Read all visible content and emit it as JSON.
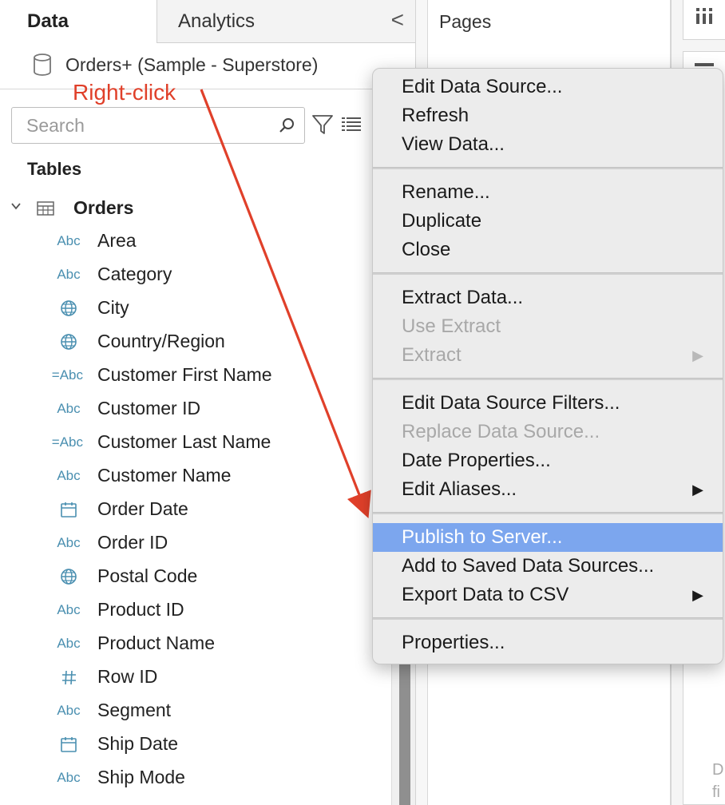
{
  "data_pane": {
    "tabs": [
      {
        "label": "Data",
        "active": true
      },
      {
        "label": "Analytics",
        "active": false
      }
    ],
    "collapse_glyph": "<",
    "data_source": {
      "name": "Orders+ (Sample - Superstore)",
      "icon": "cylinder-database-icon"
    },
    "search": {
      "placeholder": "Search",
      "value": ""
    },
    "tables_heading": "Tables",
    "table": {
      "name": "Orders",
      "fields": [
        {
          "name": "Area",
          "type": "string",
          "icon_text": "Abc"
        },
        {
          "name": "Category",
          "type": "string",
          "icon_text": "Abc"
        },
        {
          "name": "City",
          "type": "geographic",
          "icon_text": ""
        },
        {
          "name": "Country/Region",
          "type": "geographic",
          "icon_text": ""
        },
        {
          "name": "Customer First Name",
          "type": "calculated-string",
          "icon_text": "=Abc"
        },
        {
          "name": "Customer ID",
          "type": "string",
          "icon_text": "Abc"
        },
        {
          "name": "Customer Last Name",
          "type": "calculated-string",
          "icon_text": "=Abc"
        },
        {
          "name": "Customer Name",
          "type": "string",
          "icon_text": "Abc"
        },
        {
          "name": "Order Date",
          "type": "date",
          "icon_text": ""
        },
        {
          "name": "Order ID",
          "type": "string",
          "icon_text": "Abc"
        },
        {
          "name": "Postal Code",
          "type": "geographic",
          "icon_text": ""
        },
        {
          "name": "Product ID",
          "type": "string",
          "icon_text": "Abc"
        },
        {
          "name": "Product Name",
          "type": "string",
          "icon_text": "Abc"
        },
        {
          "name": "Row ID",
          "type": "number",
          "icon_text": "#"
        },
        {
          "name": "Segment",
          "type": "string",
          "icon_text": "Abc"
        },
        {
          "name": "Ship Date",
          "type": "date",
          "icon_text": ""
        },
        {
          "name": "Ship Mode",
          "type": "string",
          "icon_text": "Abc"
        }
      ]
    }
  },
  "shelves": {
    "pages_label": "Pages",
    "drop_hint": "D\nfi"
  },
  "context_menu": {
    "groups": [
      [
        {
          "label": "Edit Data Source...",
          "enabled": true
        },
        {
          "label": "Refresh",
          "enabled": true
        },
        {
          "label": "View Data...",
          "enabled": true
        }
      ],
      [
        {
          "label": "Rename...",
          "enabled": true
        },
        {
          "label": "Duplicate",
          "enabled": true
        },
        {
          "label": "Close",
          "enabled": true
        }
      ],
      [
        {
          "label": "Extract Data...",
          "enabled": true
        },
        {
          "label": "Use Extract",
          "enabled": false
        },
        {
          "label": "Extract",
          "enabled": false,
          "submenu": true
        }
      ],
      [
        {
          "label": "Edit Data Source Filters...",
          "enabled": true
        },
        {
          "label": "Replace Data Source...",
          "enabled": false
        },
        {
          "label": "Date Properties...",
          "enabled": true
        },
        {
          "label": "Edit Aliases...",
          "enabled": true,
          "submenu": true
        }
      ],
      [
        {
          "label": "Publish to Server...",
          "enabled": true,
          "highlighted": true
        },
        {
          "label": "Add to Saved Data Sources...",
          "enabled": true
        },
        {
          "label": "Export Data to CSV",
          "enabled": true,
          "submenu": true
        }
      ],
      [
        {
          "label": "Properties...",
          "enabled": true
        }
      ]
    ],
    "submenu_glyph": "▶"
  },
  "annotation": {
    "label": "Right-click",
    "color": "#e0402a"
  },
  "colors": {
    "menu_highlight": "#7ca6ee",
    "field_icon": "#4a8fb0",
    "annotation_red": "#e0402a"
  }
}
